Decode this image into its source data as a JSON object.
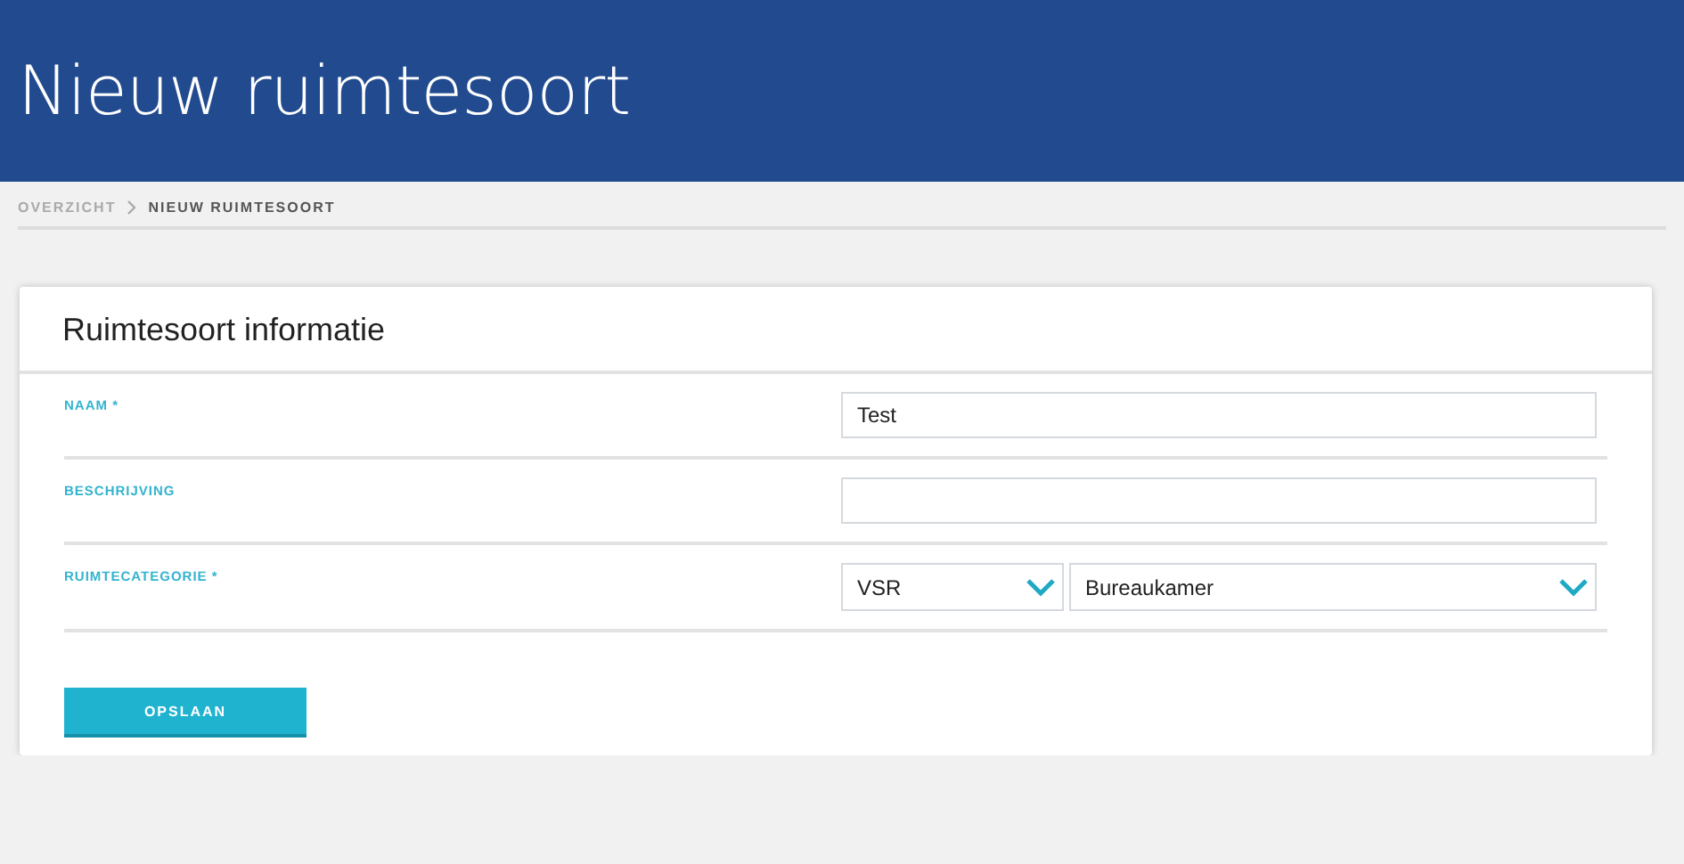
{
  "header": {
    "title": "Nieuw ruimtesoort"
  },
  "breadcrumb": [
    {
      "label": "OVERZICHT",
      "current": false
    },
    {
      "label": "NIEUW RUIMTESOORT",
      "current": true
    }
  ],
  "card": {
    "title": "Ruimtesoort informatie",
    "fields": [
      {
        "label": "NAAM *",
        "kind": "text",
        "value": "Test"
      },
      {
        "label": "BESCHRIJVING",
        "kind": "text"
      },
      {
        "label": "RUIMTECATEGORIE *",
        "kind": "selects",
        "selects": [
          "VSR",
          "Bureaukamer"
        ]
      }
    ],
    "button": "OPSLAAN"
  }
}
